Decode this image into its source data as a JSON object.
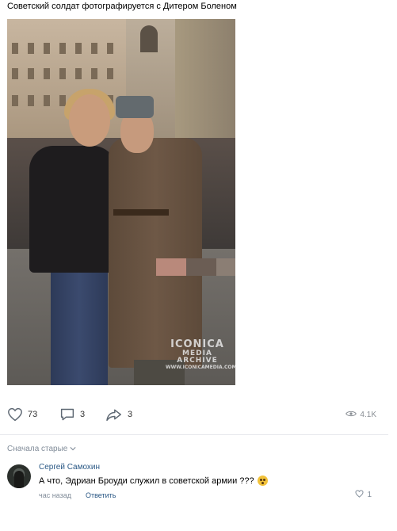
{
  "post": {
    "caption": "Советский солдат фотографируется с Дитером Боленом",
    "photo": {
      "watermark_line1": "ICONICA",
      "watermark_line2": "MEDIA ARCHIVE",
      "watermark_line3": "WWW.ICONICAMEDIA.COM"
    },
    "actions": {
      "likes": "73",
      "comments": "3",
      "shares": "3",
      "views": "4.1K"
    },
    "icons": {
      "like": "heart-icon",
      "comment": "comment-icon",
      "share": "share-icon",
      "views": "eye-icon"
    }
  },
  "comments_section": {
    "sort_label": "Сначала старые",
    "items": [
      {
        "author": "Сергей Самохин",
        "text": "А что, Эдриан Броуди служил в советской армии ???",
        "emoji": "astonished-face",
        "time": "час назад",
        "reply_label": "Ответить",
        "likes": "1"
      }
    ]
  },
  "colors": {
    "link": "#2a5885",
    "muted": "#818c99",
    "divider": "#e7e8ec"
  }
}
